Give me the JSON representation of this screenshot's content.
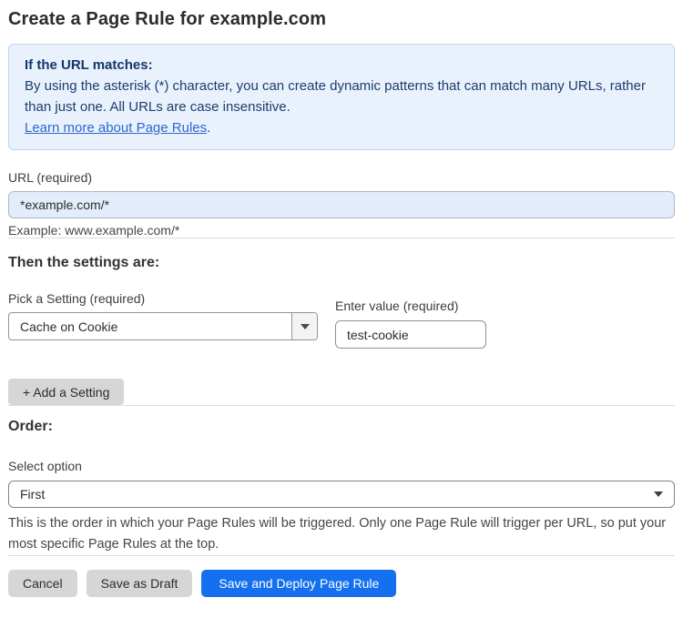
{
  "page": {
    "title": "Create a Page Rule for example.com"
  },
  "info_box": {
    "heading": "If the URL matches:",
    "body": "By using the asterisk (*) character, you can create dynamic patterns that can match many URLs, rather than just one. All URLs are case insensitive.",
    "link_label": "Learn more about Page Rules",
    "link_suffix": "."
  },
  "url_field": {
    "label": "URL (required)",
    "value": "*example.com/*",
    "helper": "Example: www.example.com/*"
  },
  "settings_section": {
    "heading": "Then the settings are:",
    "setting_select": {
      "label": "Pick a Setting (required)",
      "selected": "Cache on Cookie"
    },
    "value_field": {
      "label": "Enter value (required)",
      "value": "test-cookie"
    },
    "add_setting_label": "+ Add a Setting"
  },
  "order_section": {
    "heading": "Order:",
    "select_label": "Select option",
    "selected": "First",
    "helper": "This is the order in which your Page Rules will be triggered. Only one Page Rule will trigger per URL, so put your most specific Page Rules at the top."
  },
  "footer": {
    "cancel_label": "Cancel",
    "save_draft_label": "Save as Draft",
    "save_deploy_label": "Save and Deploy Page Rule"
  },
  "colors": {
    "accent_blue": "#1570EF",
    "info_bg": "#e9f2fc",
    "info_border": "#bcd7f2",
    "info_text": "#1d3c6e",
    "link_blue": "#2f66d0",
    "url_input_bg": "#e2ecfa",
    "button_gray": "#d6d6d6"
  }
}
